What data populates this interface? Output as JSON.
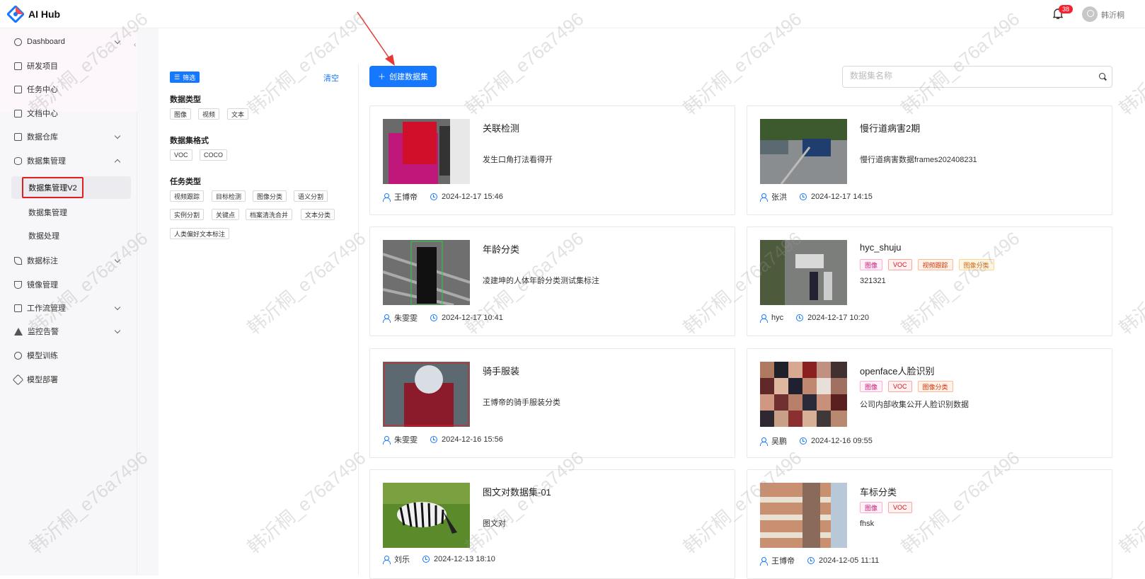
{
  "header": {
    "app_title": "AI Hub",
    "notification_count": "38",
    "user_name": "韩沂桐"
  },
  "sidebar": {
    "items": [
      {
        "label": "Dashboard"
      },
      {
        "label": "研发项目"
      },
      {
        "label": "任务中心"
      },
      {
        "label": "文档中心"
      },
      {
        "label": "数据仓库"
      },
      {
        "label": "数据集管理"
      },
      {
        "label": "数据标注"
      },
      {
        "label": "镜像管理"
      },
      {
        "label": "工作流管理"
      },
      {
        "label": "监控告警"
      },
      {
        "label": "模型训练"
      },
      {
        "label": "模型部署"
      }
    ],
    "sub_items": [
      {
        "label": "数据集管理V2"
      },
      {
        "label": "数据集管理"
      },
      {
        "label": "数据处理"
      }
    ]
  },
  "filter": {
    "filter_label": "筛选",
    "clear_label": "清空",
    "data_type_heading": "数据类型",
    "data_types": [
      "图像",
      "视频",
      "文本"
    ],
    "format_heading": "数据集格式",
    "formats": [
      "VOC",
      "COCO"
    ],
    "task_heading": "任务类型",
    "tasks": [
      "视频跟踪",
      "目标检测",
      "图像分类",
      "语义分割",
      "实例分割",
      "关键点",
      "档案清洗合并",
      "文本分类",
      "人类偏好文本标注"
    ]
  },
  "toolbar": {
    "create_label": "创建数据集",
    "search_placeholder": "数据集名称"
  },
  "datasets": [
    {
      "title": "关联检测",
      "desc": "发生口角打法看得开",
      "user": "王博帝",
      "time": "2024-12-17 15:46",
      "tags": []
    },
    {
      "title": "慢行道病害2期",
      "desc": "慢行道病害数据frames202408231",
      "user": "张洪",
      "time": "2024-12-17 14:15",
      "tags": []
    },
    {
      "title": "年龄分类",
      "desc": "凌建坤的人体年龄分类测试集标注",
      "user": "朱雯雯",
      "time": "2024-12-17 10:41",
      "tags": []
    },
    {
      "title": "hyc_shuju",
      "desc": "321321",
      "user": "hyc",
      "time": "2024-12-17 10:20",
      "tags": [
        "图像",
        "VOC",
        "视频跟踪",
        "图像分类"
      ]
    },
    {
      "title": "骑手服装",
      "desc": "王博帝的骑手服装分类",
      "user": "朱雯雯",
      "time": "2024-12-16 15:56",
      "tags": []
    },
    {
      "title": "openface人脸识别",
      "desc": "公司内部收集公开人脸识别数据",
      "user": "吴鹏",
      "time": "2024-12-16 09:55",
      "tags": [
        "图像",
        "VOC",
        "图像分类"
      ]
    },
    {
      "title": "图文对数据集-01",
      "desc": "图文对",
      "user": "刘乐",
      "time": "2024-12-13 18:10",
      "tags": []
    },
    {
      "title": "车标分类",
      "desc": "fhsk",
      "user": "王博帝",
      "time": "2024-12-05 11:11",
      "tags": [
        "图像",
        "VOC"
      ]
    }
  ],
  "watermark": "韩沂桐_e76a7496",
  "colors": {
    "primary": "#1677ff",
    "highlight_box": "#e02020",
    "arrow": "#e53935"
  }
}
